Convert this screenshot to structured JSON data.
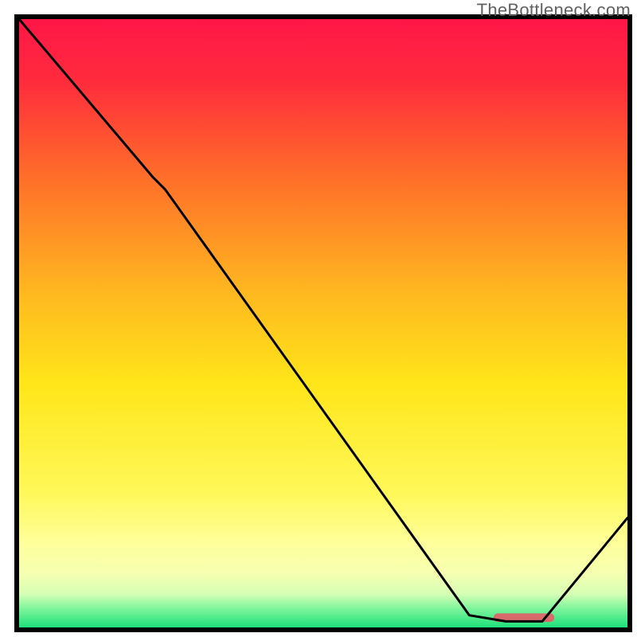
{
  "watermark": "TheBottleneck.com",
  "chart_data": {
    "type": "line",
    "title": "",
    "xlabel": "",
    "ylabel": "",
    "xlim": [
      0,
      100
    ],
    "ylim": [
      0,
      100
    ],
    "grid": false,
    "legend": false,
    "annotations": [],
    "gradient_stops": [
      {
        "offset": 0.0,
        "color": "#ff1648"
      },
      {
        "offset": 0.1,
        "color": "#ff2b3d"
      },
      {
        "offset": 0.25,
        "color": "#ff6a2a"
      },
      {
        "offset": 0.45,
        "color": "#ffb820"
      },
      {
        "offset": 0.6,
        "color": "#ffe61a"
      },
      {
        "offset": 0.78,
        "color": "#fff85a"
      },
      {
        "offset": 0.86,
        "color": "#ffff9a"
      },
      {
        "offset": 0.91,
        "color": "#f6ffb0"
      },
      {
        "offset": 0.945,
        "color": "#d6ffb5"
      },
      {
        "offset": 0.965,
        "color": "#8cf7a0"
      },
      {
        "offset": 1.0,
        "color": "#1de07a"
      }
    ],
    "series": [
      {
        "name": "curve",
        "color": "#000000",
        "x": [
          0,
          22,
          24,
          74,
          80,
          86,
          100
        ],
        "values": [
          100,
          74,
          72,
          2,
          1,
          1,
          18
        ]
      }
    ],
    "marker": {
      "name": "optimal-range",
      "color": "#d96a6b",
      "x_start": 78,
      "x_end": 88,
      "y": 1.6,
      "height_pct": 1.4
    }
  }
}
